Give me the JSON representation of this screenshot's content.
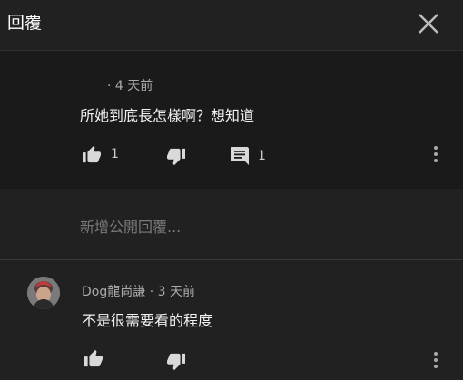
{
  "header": {
    "title": "回覆"
  },
  "parent_comment": {
    "time": "4 天前",
    "text": "所她到底長怎樣啊？想知道",
    "like_count": "1",
    "reply_count": "1"
  },
  "reply_input": {
    "placeholder": "新增公開回覆..."
  },
  "reply": {
    "author": "Dog龍尚謙",
    "time": "3 天前",
    "text": "不是很需要看的程度"
  },
  "icons": {
    "close": "close-icon",
    "like": "thumb-up-icon",
    "dislike": "thumb-down-icon",
    "reply": "comment-icon",
    "more": "more-vert-icon"
  },
  "colors": {
    "background": "#212121",
    "parent_background": "#1a1a1a",
    "secondary_text": "#aaaaaa"
  }
}
